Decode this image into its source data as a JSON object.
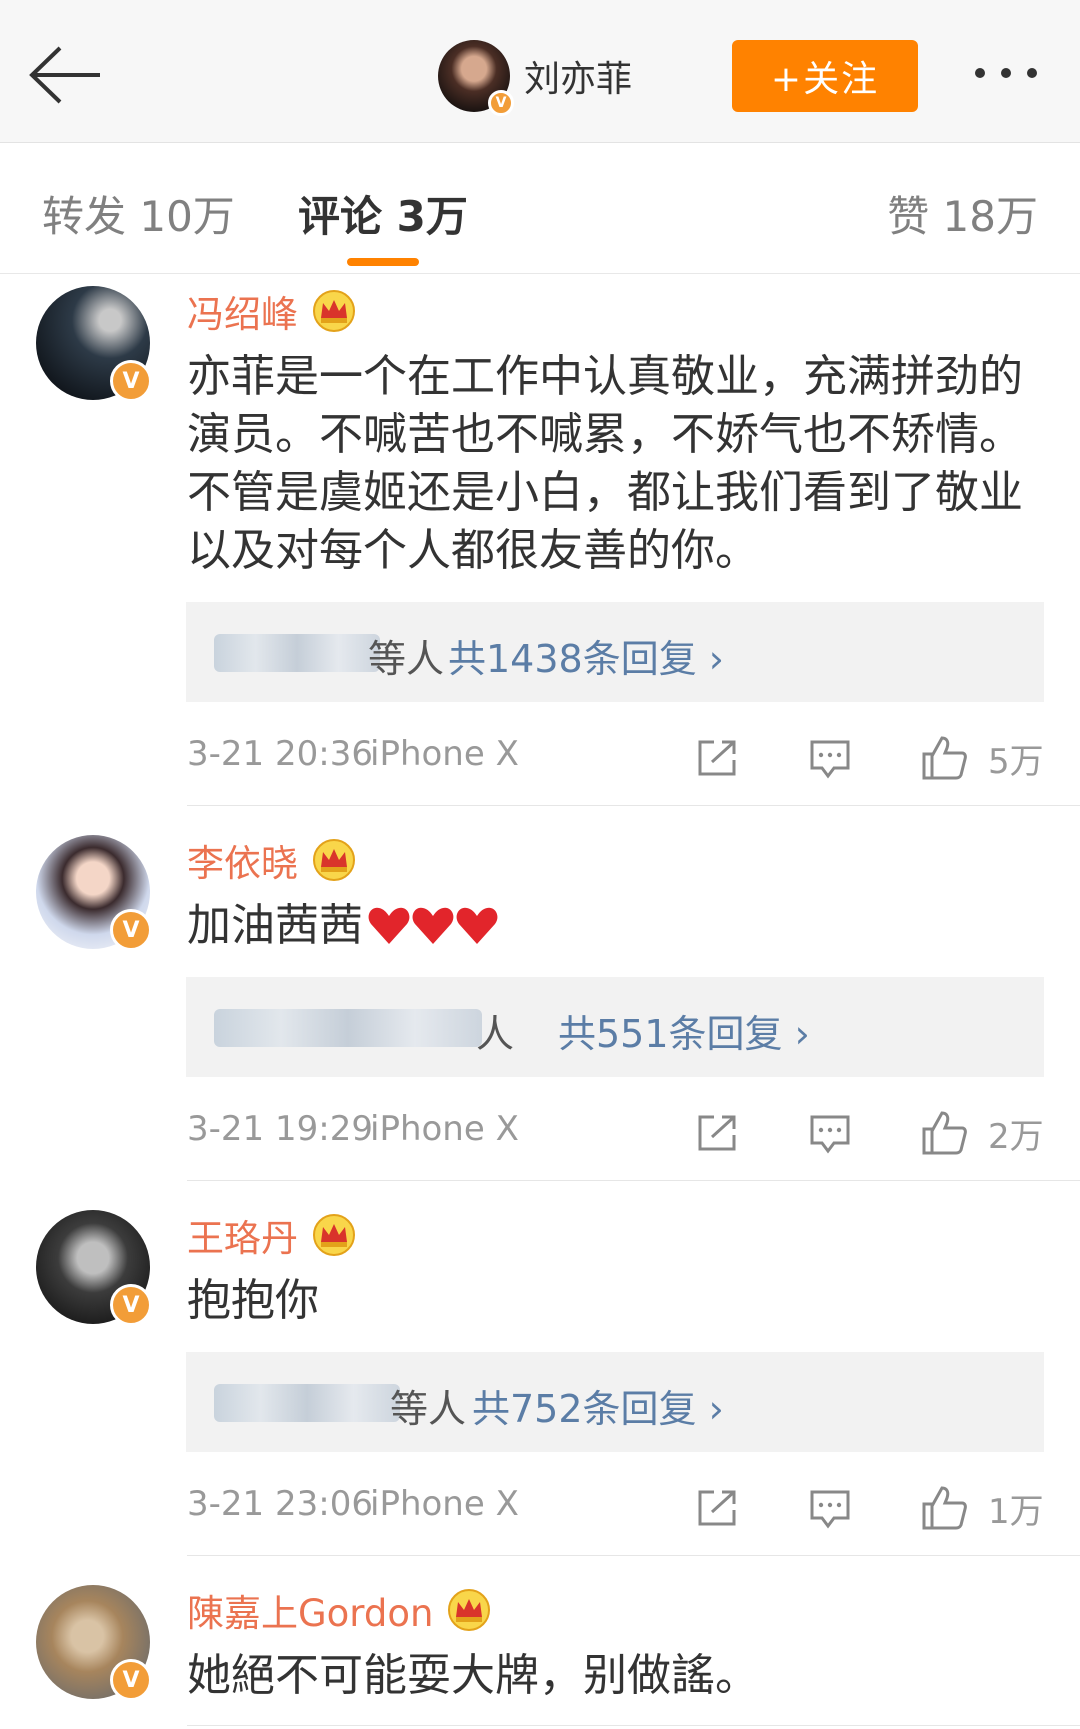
{
  "header": {
    "back_icon": "arrow-left-icon",
    "author_name": "刘亦菲",
    "follow_label": "+关注",
    "more_icon": "more-dots-icon"
  },
  "tabs": {
    "repost": "转发 10万",
    "comment": "评论 3万",
    "like": "赞 18万"
  },
  "comments": [
    {
      "name": "冯绍峰",
      "text": "亦菲是一个在工作中认真敬业，充满拼劲的演员。不喊苦也不喊累，不娇气也不矫情。不管是虞姬还是小白，都让我们看到了敬业以及对每个人都很友善的你。",
      "reply_suffix": "等人",
      "reply_link": "共1438条回复 ›",
      "time": "3-21 20:36",
      "device": "iPhone X",
      "likes": "5万"
    },
    {
      "name": "李依晓",
      "text": "加油茜茜",
      "reply_suffix": "人",
      "reply_link": "共551条回复 ›",
      "time": "3-21 19:29",
      "device": "iPhone X",
      "likes": "2万"
    },
    {
      "name": "王珞丹",
      "text": "抱抱你",
      "reply_suffix": "等人",
      "reply_link": "共752条回复 ›",
      "time": "3-21 23:06",
      "device": "iPhone X",
      "likes": "1万"
    },
    {
      "name": "陳嘉上Gordon",
      "text": "她絕不可能耍大牌，别做謠。"
    }
  ],
  "verified_badge": "V",
  "colors": {
    "accent": "#ff8200",
    "username": "#eb7350",
    "reply_link": "#5b7da6"
  },
  "icons": [
    "crown-icon",
    "share-icon",
    "comment-icon",
    "like-icon",
    "heart-icon"
  ]
}
